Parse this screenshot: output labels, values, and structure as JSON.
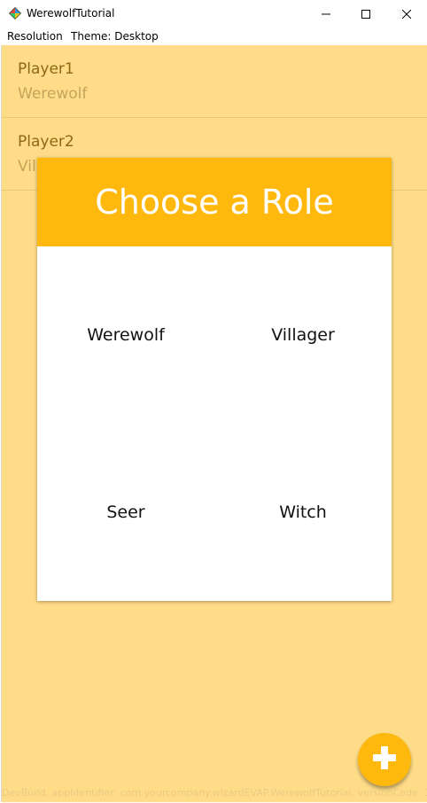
{
  "window": {
    "title": "WerewolfTutorial",
    "icon": "app-icon",
    "controls": [
      "minimize-icon",
      "maximize-icon",
      "close-icon"
    ]
  },
  "menu": {
    "resolution": "Resolution",
    "theme": "Theme: Desktop"
  },
  "players": [
    {
      "name": "Player1",
      "role": "Werewolf"
    },
    {
      "name": "Player2",
      "role": "Villager"
    }
  ],
  "dialog": {
    "title": "Choose a Role",
    "roles": [
      "Werewolf",
      "Villager",
      "Seer",
      "Witch"
    ]
  },
  "fab": {
    "icon": "plus-icon"
  },
  "footer": "DevBuild, appIdentifier: com.yourcompany.wizardEVAP.WerewolfTutorial, versionCode: 1",
  "colors": {
    "background": "#ffdd88",
    "accent": "#ffb90e",
    "player_name": "#8a6a15",
    "player_role": "#c4a45a"
  }
}
